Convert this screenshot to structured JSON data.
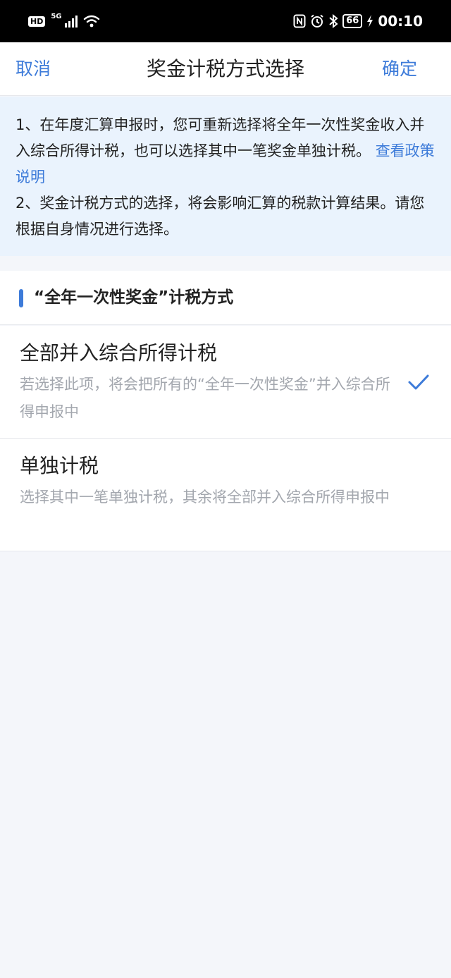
{
  "status_bar": {
    "hd": "HD",
    "network": "5G",
    "battery": "66",
    "time": "00:10"
  },
  "nav": {
    "cancel_label": "取消",
    "title": "奖金计税方式选择",
    "confirm_label": "确定"
  },
  "notice": {
    "line1_text": "1、在年度汇算申报时，您可重新选择将全年一次性奖金收入并入综合所得计税，也可以选择其中一笔奖金单独计税。",
    "policy_link": "查看政策说明",
    "line2_text": "2、奖金计税方式的选择，将会影响汇算的税款计算结果。请您根据自身情况进行选择。"
  },
  "section": {
    "title": "“全年一次性奖金”计税方式"
  },
  "options": [
    {
      "title": "全部并入综合所得计税",
      "description": "若选择此项，将会把所有的“全年一次性奖金”并入综合所得申报中",
      "selected": true
    },
    {
      "title": "单独计税",
      "description": "选择其中一笔单独计税，其余将全部并入综合所得申报中",
      "selected": false
    }
  ],
  "colors": {
    "accent": "#3d7bd9",
    "notice_bg": "#eaf3fd",
    "page_bg": "#f4f6fa"
  }
}
